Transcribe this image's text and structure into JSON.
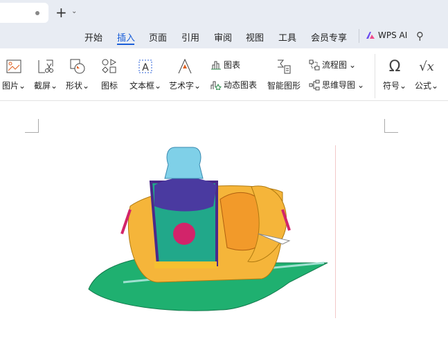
{
  "tabbar": {
    "new_tab": "+",
    "dropdown": "⌄"
  },
  "menu": [
    "开始",
    "插入",
    "页面",
    "引用",
    "审阅",
    "视图",
    "工具",
    "会员专享"
  ],
  "active_menu": "插入",
  "wps_ai": "WPS AI",
  "ribbon": {
    "picture": "图片",
    "screenshot": "截屏",
    "shape": "形状",
    "icon": "图标",
    "textbox": "文本框",
    "wordart": "艺术字",
    "chart": "图表",
    "dynamic_chart": "动态图表",
    "smart_graphic": "智能图形",
    "flowchart": "流程图",
    "mindmap": "思维导图",
    "symbol": "符号",
    "formula": "公式"
  },
  "colors": {
    "accent": "#1a5ed8"
  }
}
